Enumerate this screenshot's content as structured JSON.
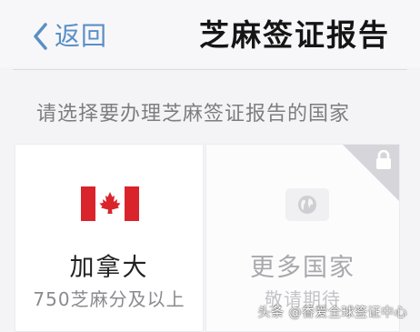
{
  "nav": {
    "back_label": "返回",
    "title": "芝麻签证报告"
  },
  "prompt": "请选择要办理芝麻签证报告的国家",
  "countries": [
    {
      "name": "加拿大",
      "requirement": "750芝麻分及以上",
      "flag": "canada-flag-icon",
      "enabled": true
    },
    {
      "name": "更多国家",
      "requirement": "敬请期待",
      "icon": "globe-icon",
      "locked": true,
      "enabled": false
    }
  ],
  "watermark": "头条 @香爱全球签证中心",
  "colors": {
    "accent": "#5a8fc6",
    "flag_red": "#d9242b",
    "background": "#f4f4f6"
  }
}
